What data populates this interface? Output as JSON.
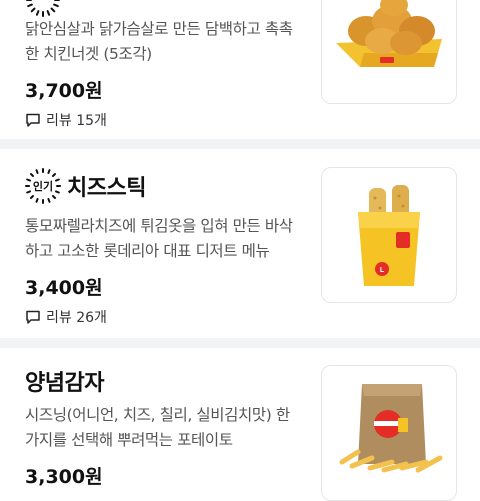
{
  "menu": {
    "items": [
      {
        "title": "",
        "description_line1": "닭안심살과 닭가슴살로  만든 담백하고 촉촉",
        "description_line2": "한 치킨너겟 (5조각)",
        "price": "3,700원",
        "review_label": "리뷰 15개",
        "thumbnail_icon": "chicken-nuggets-icon"
      },
      {
        "badge": "인기",
        "title": "치즈스틱",
        "description_line1": "통모짜렐라치즈에 튀김옷을 입혀 만든 바삭",
        "description_line2": "하고 고소한 롯데리아 대표 디저트 메뉴",
        "price": "3,400원",
        "review_label": "리뷰 26개",
        "thumbnail_icon": "cheese-stick-icon"
      },
      {
        "title": "양념감자",
        "description_line1": "시즈닝(어니언, 치즈, 칠리, 실비김치맛) 한",
        "description_line2": "가지를 선택해 뿌려먹는 포테이토",
        "price": "3,300원",
        "thumbnail_icon": "seasoned-fries-icon"
      }
    ]
  },
  "colors": {
    "divider": "#f2f3f5",
    "accent": "#e52d27",
    "box_yellow": "#f6c324"
  }
}
